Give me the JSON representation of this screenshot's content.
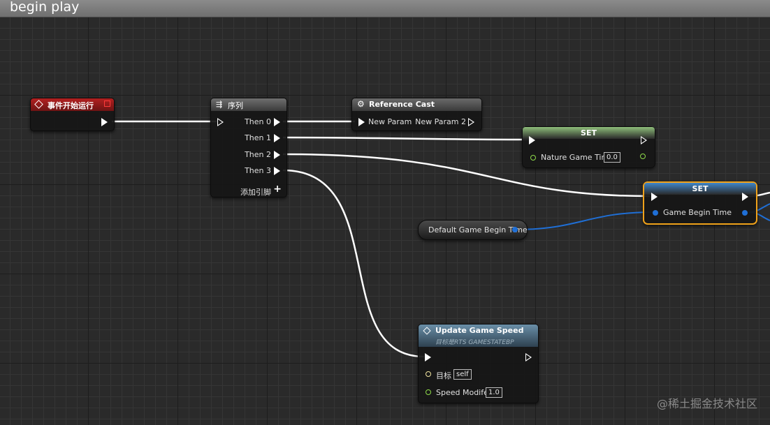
{
  "title": "begin play",
  "nodes": {
    "event_begin": {
      "title": "事件开始运行"
    },
    "sequence": {
      "title": "序列",
      "pins": [
        "Then 0",
        "Then 1",
        "Then 2",
        "Then 3"
      ],
      "add_pin": "添加引脚"
    },
    "ref_cast": {
      "title": "Reference Cast",
      "in_pin": "New Param",
      "out_pin": "New Param 2"
    },
    "set_nature": {
      "title": "SET",
      "pin": "Nature Game Time",
      "value": "0.0"
    },
    "set_game_begin": {
      "title": "SET",
      "pin": "Game Begin Time"
    },
    "default_begin": {
      "label": "Default Game Begin Time"
    },
    "update_speed": {
      "title": "Update Game Speed",
      "subtitle": "目标是RTS GAMESTATEBP",
      "target_label": "目标",
      "target_value": "self",
      "speed_label": "Speed Modifer",
      "speed_value": "1.0"
    }
  },
  "watermark": "@稀土掘金技术社区",
  "colors": {
    "event_header": "#a81a1a",
    "exec_wire": "#ffffff",
    "float_pin": "#8fdc4a",
    "time_pin": "#1f6fd6",
    "selected_border": "#f0a21a"
  }
}
